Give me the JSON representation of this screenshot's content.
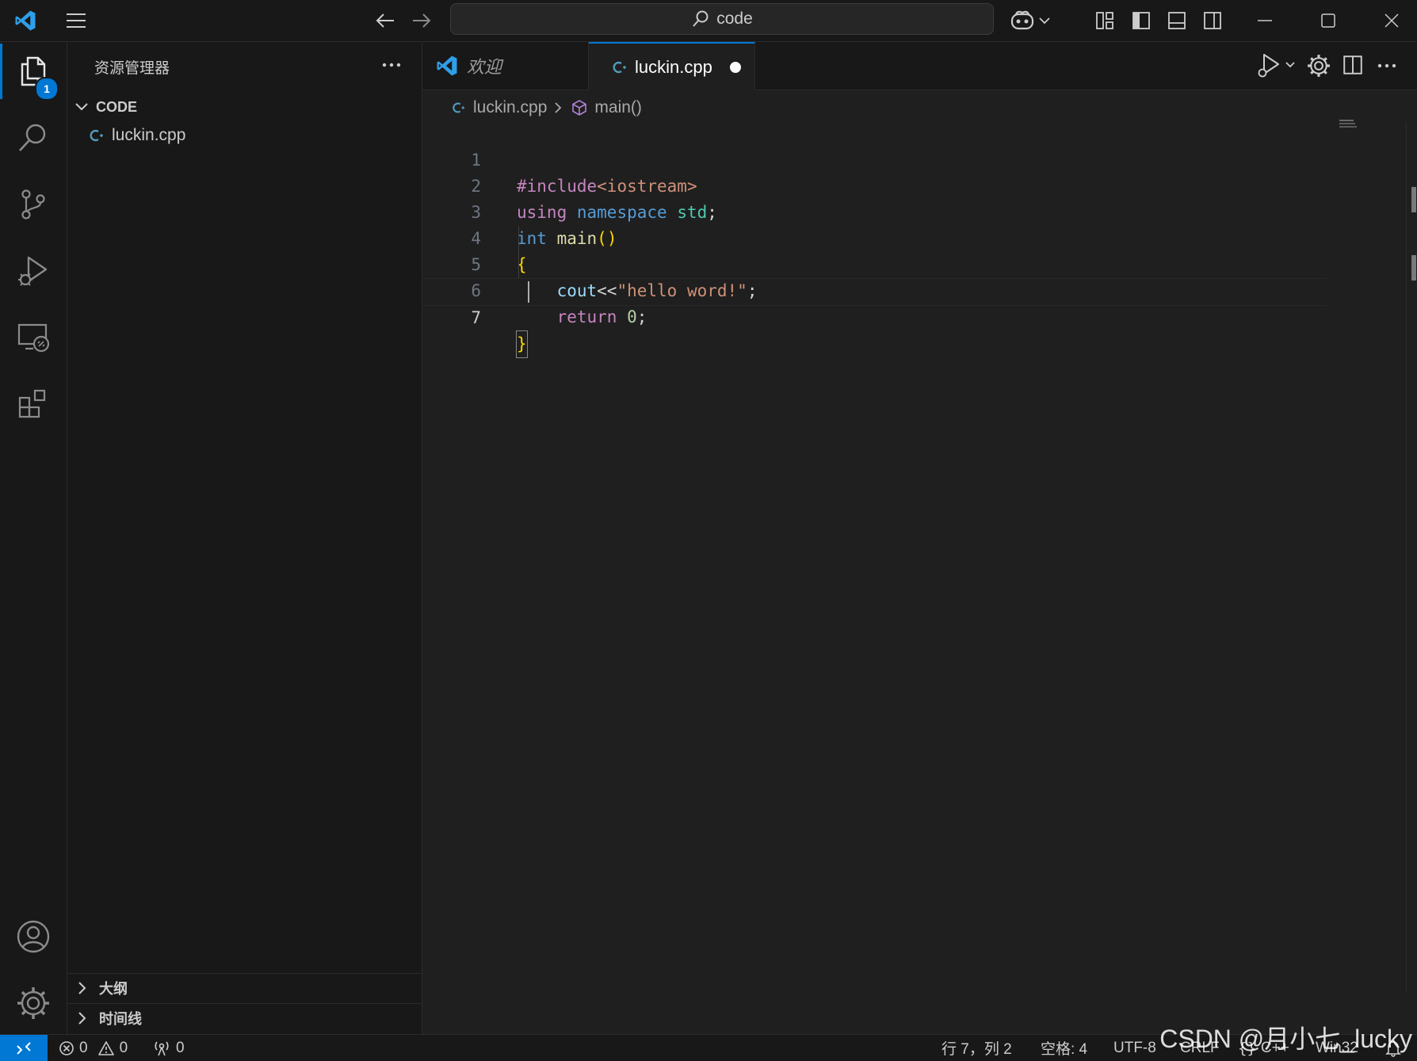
{
  "titlebar": {
    "search_text": "code"
  },
  "activity": {
    "explorer_badge": "1"
  },
  "sidebar": {
    "title": "资源管理器",
    "folder_label": "CODE",
    "files": [
      {
        "name": "luckin.cpp"
      }
    ],
    "sections": [
      {
        "label": "大纲"
      },
      {
        "label": "时间线"
      }
    ]
  },
  "tabs": [
    {
      "label": "欢迎",
      "active": false
    },
    {
      "label": "luckin.cpp",
      "active": true,
      "modified": true
    }
  ],
  "breadcrumb": {
    "file": "luckin.cpp",
    "symbol": "main()"
  },
  "editor": {
    "line_numbers": [
      "1",
      "2",
      "3",
      "4",
      "5",
      "6",
      "7"
    ],
    "active_line": 7,
    "lines": [
      "#include<iostream>",
      "using namespace std;",
      "int main()",
      "{",
      "    cout<<\"hello word!\";",
      "    return 0;",
      "}"
    ]
  },
  "statusbar": {
    "errors": "0",
    "warnings": "0",
    "ports": "0",
    "cursor_position": "行 7，列 2",
    "indentation": "空格: 4",
    "encoding": "UTF-8",
    "eol": "CRLF",
    "language": "C++",
    "platform": "Win32"
  },
  "watermark": "CSDN @月小七_lucky",
  "colors": {
    "accent": "#0078d4",
    "remote": "#0078d4",
    "keyword_purple": "#c586c0",
    "keyword_blue": "#569cd6",
    "string": "#ce9178",
    "bracket": "#ffd700"
  },
  "icons": [
    "vscode-logo-icon",
    "menu-icon",
    "back-arrow-icon",
    "forward-arrow-icon",
    "search-icon",
    "copilot-icon",
    "chevron-down-icon",
    "customize-layout-icon",
    "toggle-primary-sidebar-icon",
    "toggle-panel-icon",
    "toggle-secondary-sidebar-icon",
    "minimize-icon",
    "maximize-icon",
    "close-icon",
    "explorer-icon",
    "search-activity-icon",
    "source-control-icon",
    "run-debug-icon",
    "remote-explorer-icon",
    "extensions-icon",
    "accounts-icon",
    "manage-gear-icon",
    "more-actions-icon",
    "cpp-file-icon",
    "symbol-method-icon",
    "split-editor-icon",
    "error-icon",
    "warning-icon",
    "broadcast-icon",
    "notifications-bell-icon",
    "remote-indicator-icon",
    "braces-icon"
  ]
}
